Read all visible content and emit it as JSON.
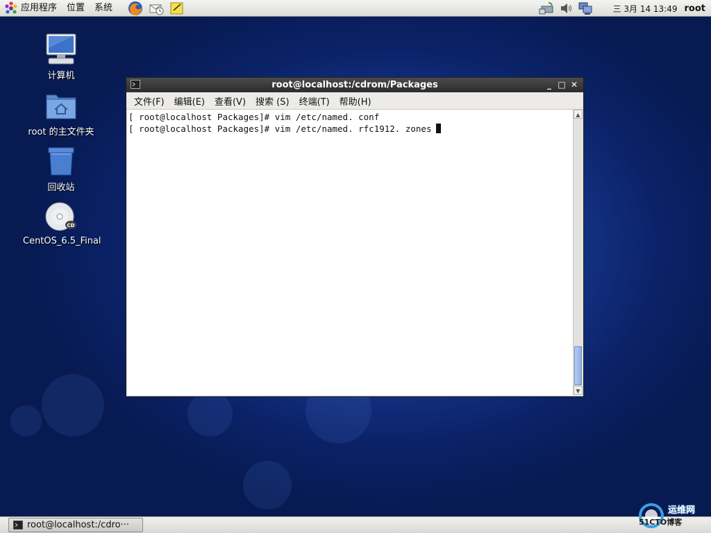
{
  "top_panel": {
    "menu": {
      "applications": "应用程序",
      "places": "位置",
      "system": "系统"
    },
    "launchers": [
      "firefox-icon",
      "mail-icon",
      "notes-icon"
    ],
    "tray": [
      "network-icon",
      "volume-icon",
      "display-icon"
    ],
    "clock": "三 3月 14 13:49",
    "user": "root"
  },
  "desktop": {
    "icons": [
      {
        "label": "计算机",
        "icon": "computer-icon"
      },
      {
        "label": "root 的主文件夹",
        "icon": "home-folder-icon"
      },
      {
        "label": "回收站",
        "icon": "trash-icon"
      },
      {
        "label": "CentOS_6.5_Final",
        "icon": "cd-icon"
      }
    ]
  },
  "window": {
    "title": "root@localhost:/cdrom/Packages",
    "menu": [
      "文件(F)",
      "编辑(E)",
      "查看(V)",
      "搜索 (S)",
      "终端(T)",
      "帮助(H)"
    ],
    "lines": [
      "[ root@localhost Packages]# vim /etc/named. conf",
      "[ root@localhost Packages]# vim /etc/named. rfc1912. zones"
    ]
  },
  "taskbar": {
    "task_label": "root@localhost:/cdro···"
  },
  "watermark": {
    "site": "运维网",
    "logo": "51CTO博客"
  },
  "colors": {
    "desktop": "#16378c",
    "titlebar": "#2c2c2c",
    "panel": "#e6e6e2"
  }
}
